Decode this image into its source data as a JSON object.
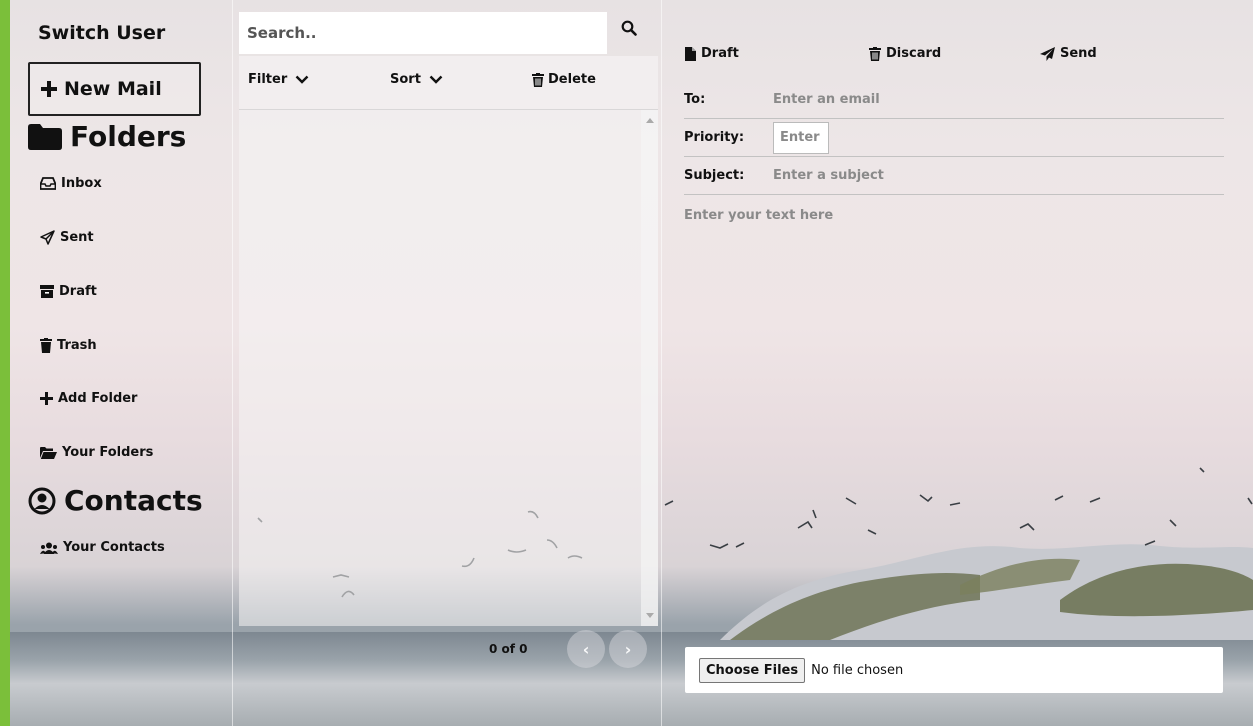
{
  "sidebar": {
    "switch_user": "Switch User",
    "new_mail": "New Mail",
    "folders_title": "Folders",
    "items": [
      {
        "label": "Inbox",
        "icon": "inbox-icon"
      },
      {
        "label": "Sent",
        "icon": "paper-plane-icon"
      },
      {
        "label": "Draft",
        "icon": "archive-icon"
      },
      {
        "label": "Trash",
        "icon": "trash-icon"
      },
      {
        "label": "Add Folder",
        "icon": "plus-icon"
      },
      {
        "label": "Your Folders",
        "icon": "folder-open-icon"
      }
    ],
    "contacts_title": "Contacts",
    "contacts_items": [
      {
        "label": "Your Contacts",
        "icon": "users-icon"
      }
    ]
  },
  "mail_list": {
    "search_placeholder": "Search..",
    "filter_label": "Filter",
    "sort_label": "Sort",
    "delete_label": "Delete",
    "pagination": "0 of 0"
  },
  "compose": {
    "draft_label": "Draft",
    "discard_label": "Discard",
    "send_label": "Send",
    "to_label": "To:",
    "to_placeholder": "Enter an email",
    "priority_label": "Priority:",
    "priority_placeholder": "Enter",
    "subject_label": "Subject:",
    "subject_placeholder": "Enter a subject",
    "body_placeholder": "Enter your text here",
    "file_button": "Choose Files",
    "file_status": "No file chosen"
  },
  "colors": {
    "accent_bar": "#7bbf3a"
  }
}
